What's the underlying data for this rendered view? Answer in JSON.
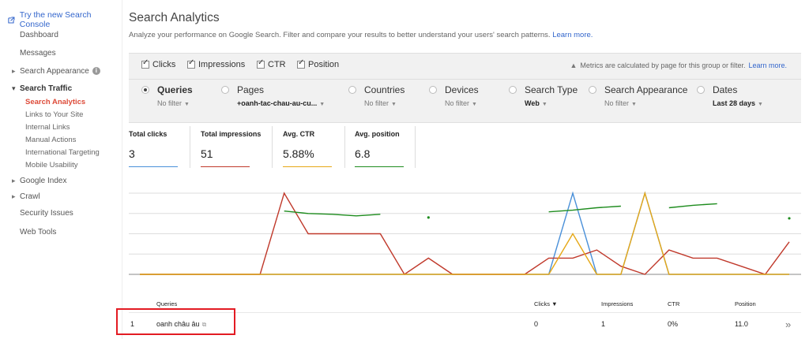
{
  "sidebar": {
    "try_link": "Try the new Search Console",
    "dashboard": "Dashboard",
    "messages": "Messages",
    "search_appearance": "Search Appearance",
    "search_traffic": "Search Traffic",
    "search_analytics": "Search Analytics",
    "links_to_site": "Links to Your Site",
    "internal_links": "Internal Links",
    "manual_actions": "Manual Actions",
    "international_targeting": "International Targeting",
    "mobile_usability": "Mobile Usability",
    "google_index": "Google Index",
    "crawl": "Crawl",
    "security_issues": "Security Issues",
    "web_tools": "Web Tools"
  },
  "header": {
    "title": "Search Analytics",
    "description": "Analyze your performance on Google Search. Filter and compare your results to better understand your users' search patterns.",
    "learn_more": "Learn more."
  },
  "metrics": {
    "clicks": "Clicks",
    "impressions": "Impressions",
    "ctr": "CTR",
    "position": "Position",
    "note": "Metrics are calculated by page for this group or filter.",
    "note_link": "Learn more."
  },
  "dimensions": [
    {
      "name": "Queries",
      "filter": "No filter"
    },
    {
      "name": "Pages",
      "filter": "+oanh-tac-chau-au-cu..."
    },
    {
      "name": "Countries",
      "filter": "No filter"
    },
    {
      "name": "Devices",
      "filter": "No filter"
    },
    {
      "name": "Search Type",
      "filter": "Web"
    },
    {
      "name": "Search Appearance",
      "filter": "No filter"
    },
    {
      "name": "Dates",
      "filter": "Last 28 days"
    }
  ],
  "totals": [
    {
      "label": "Total clicks",
      "value": "3",
      "color": "#4a90d9"
    },
    {
      "label": "Total impressions",
      "value": "51",
      "color": "#c0392b"
    },
    {
      "label": "Avg. CTR",
      "value": "5.88%",
      "color": "#e6a817"
    },
    {
      "label": "Avg. position",
      "value": "6.8",
      "color": "#1e8c1e"
    }
  ],
  "chart_data": {
    "type": "line",
    "x": [
      1,
      2,
      3,
      4,
      5,
      6,
      7,
      8,
      9,
      10,
      11,
      12,
      13,
      14,
      15,
      16,
      17,
      18,
      19,
      20,
      21,
      22,
      23,
      24,
      25,
      26,
      27,
      28
    ],
    "series": [
      {
        "key": "clicks",
        "color": "#4a90d9",
        "values": [
          0,
          0,
          0,
          0,
          0,
          0,
          0,
          0,
          0,
          0,
          0,
          0,
          0,
          0,
          0,
          0,
          0,
          0,
          1,
          0,
          0,
          1,
          0,
          0,
          0,
          0,
          0,
          0
        ]
      },
      {
        "key": "impressions",
        "color": "#c0392b",
        "values": [
          0,
          0,
          0,
          0,
          0,
          0,
          10,
          5,
          5,
          5,
          5,
          0,
          2,
          0,
          0,
          0,
          0,
          2,
          2,
          3,
          1,
          0,
          3,
          2,
          2,
          1,
          0,
          4
        ]
      },
      {
        "key": "ctr",
        "color": "#e6a817",
        "values": [
          0,
          0,
          0,
          0,
          0,
          0,
          0,
          0,
          0,
          0,
          0,
          0,
          0,
          0,
          0,
          0,
          0,
          0,
          50,
          0,
          0,
          100,
          0,
          0,
          0,
          0,
          0,
          0
        ]
      },
      {
        "key": "position",
        "color": "#1e8c1e",
        "values": [
          null,
          null,
          null,
          null,
          null,
          null,
          3.2,
          3.5,
          3.6,
          3.8,
          3.6,
          null,
          4.0,
          null,
          null,
          null,
          null,
          3.3,
          3.1,
          2.8,
          2.6,
          null,
          2.8,
          2.5,
          2.3,
          null,
          null,
          4.1
        ]
      }
    ]
  },
  "table": {
    "headers": {
      "queries": "Queries",
      "clicks": "Clicks ▼",
      "impressions": "Impressions",
      "ctr": "CTR",
      "position": "Position"
    },
    "rows": [
      {
        "index": "1",
        "query": "oanh châu âu",
        "clicks": "0",
        "impressions": "1",
        "ctr": "0%",
        "position": "11.0"
      }
    ]
  }
}
